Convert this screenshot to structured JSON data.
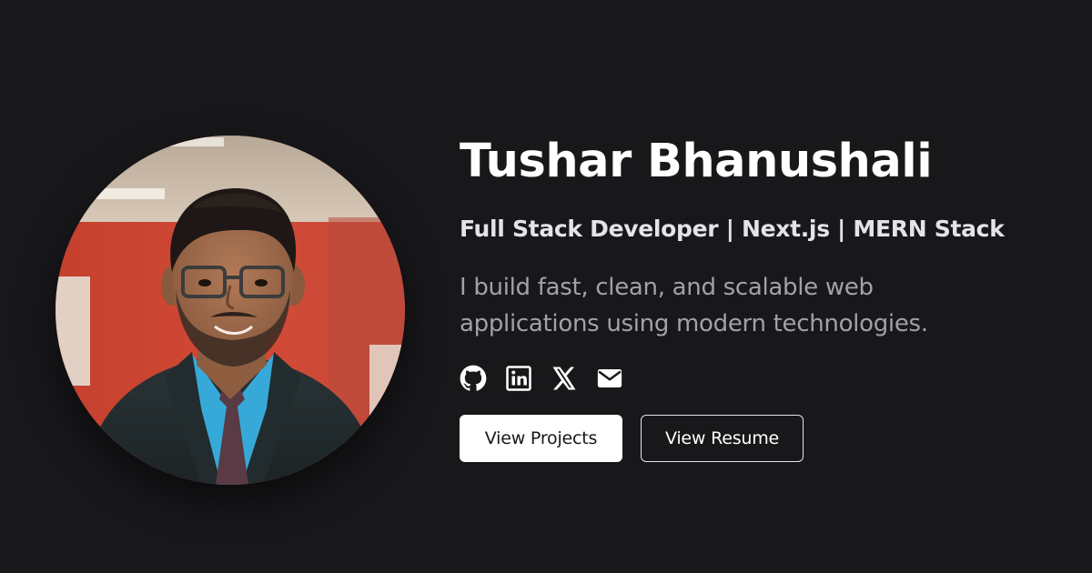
{
  "profile": {
    "name": "Tushar Bhanushali",
    "headline": "Full Stack Developer | Next.js | MERN Stack",
    "tagline": "I build fast, clean, and scalable web applications using modern technologies.",
    "avatar_icon": "profile-photo"
  },
  "socials": [
    {
      "name": "GitHub",
      "icon": "github-icon"
    },
    {
      "name": "LinkedIn",
      "icon": "linkedin-icon"
    },
    {
      "name": "X",
      "icon": "x-icon"
    },
    {
      "name": "Email",
      "icon": "mail-icon"
    }
  ],
  "actions": {
    "primary_label": "View Projects",
    "secondary_label": "View Resume"
  },
  "colors": {
    "background": "#18181b",
    "primary_text": "#ffffff",
    "headline_text": "#e4e4e7",
    "muted_text": "#a1a1aa"
  }
}
